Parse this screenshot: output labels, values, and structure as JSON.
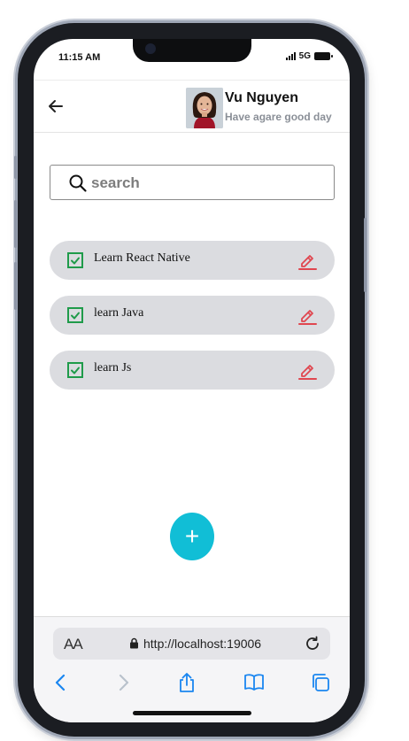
{
  "status_bar": {
    "time": "11:15 AM",
    "network": "5G"
  },
  "header": {
    "user_name": "Vu Nguyen",
    "subtitle": "Have agare good day"
  },
  "search": {
    "placeholder": "search",
    "value": ""
  },
  "tasks": [
    {
      "label": "Learn React Native",
      "checked": true
    },
    {
      "label": "learn Java",
      "checked": true
    },
    {
      "label": "learn Js",
      "checked": true
    }
  ],
  "fab": {
    "label": "+"
  },
  "browser": {
    "text_size_label": "AA",
    "url": "http://localhost:19006"
  },
  "colors": {
    "accent": "#11bed6",
    "check_green": "#1f9b4a",
    "edit_red": "#e0464f",
    "task_bg": "#dbdce0",
    "browser_blue": "#1a86f0"
  },
  "icons": [
    "back-arrow-icon",
    "search-icon",
    "checkbox-checked-icon",
    "edit-pencil-icon",
    "plus-icon",
    "lock-icon",
    "reload-icon",
    "chevron-left-icon",
    "chevron-right-icon",
    "share-icon",
    "bookmarks-icon",
    "tabs-icon"
  ]
}
